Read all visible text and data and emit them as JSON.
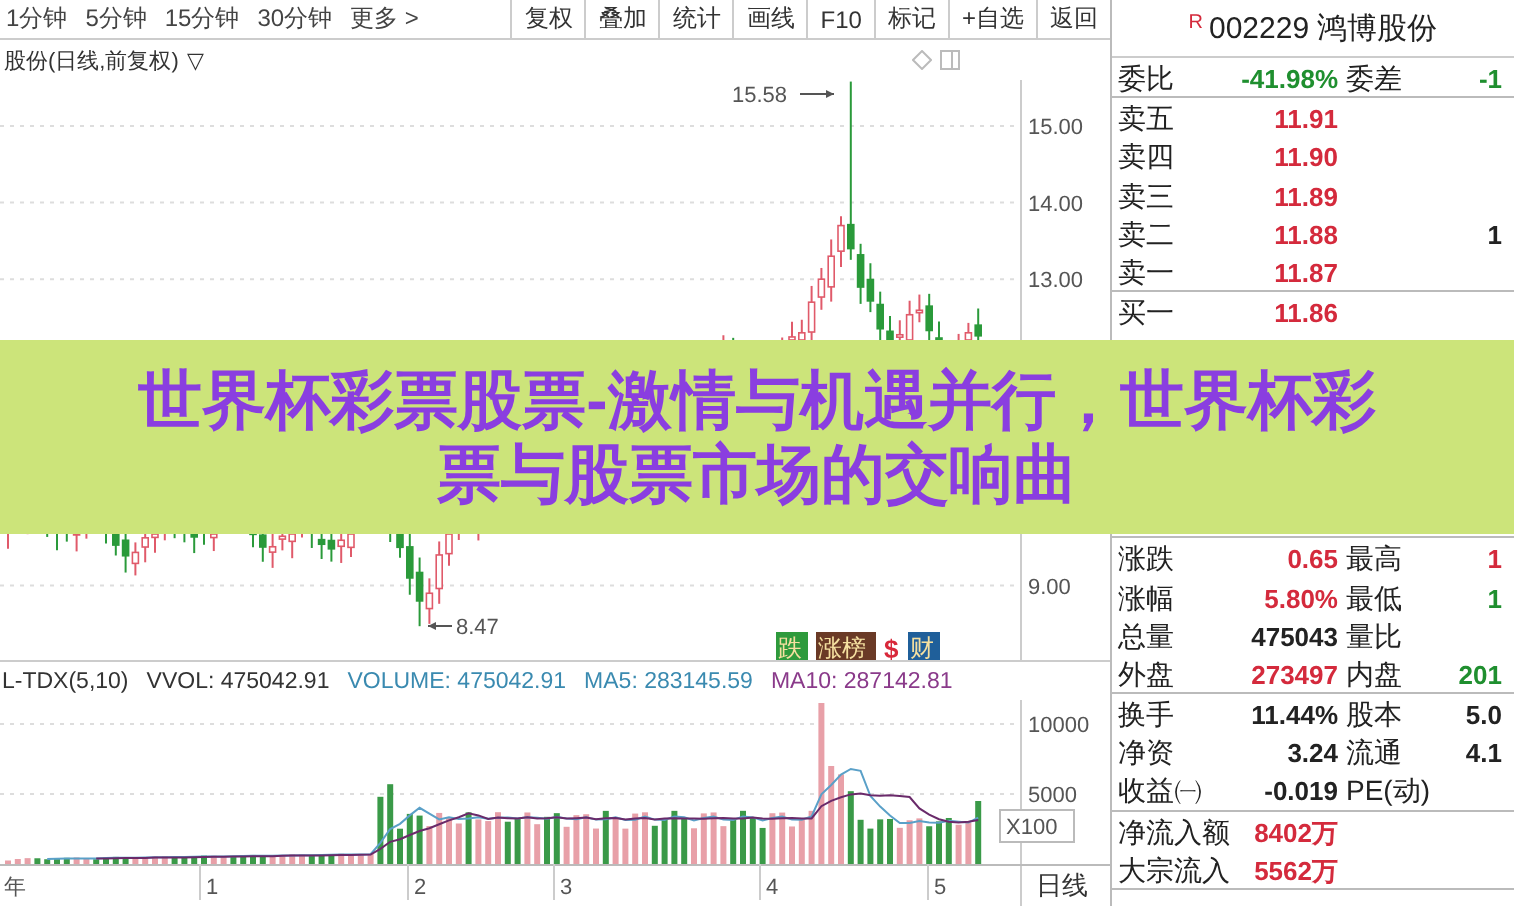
{
  "toolbar": {
    "periods": [
      "1分钟",
      "5分钟",
      "15分钟",
      "30分钟"
    ],
    "more": "更多 >",
    "buttons": [
      "复权",
      "叠加",
      "统计",
      "画线",
      "F10",
      "标记",
      "+自选",
      "返回"
    ]
  },
  "chart": {
    "title": "股份(日线,前复权)",
    "title_menu": "▽",
    "price_axis": [
      "15.00",
      "14.00",
      "13.00",
      "9.00"
    ],
    "high_label": "15.58",
    "low_label": "8.47",
    "badges": [
      {
        "text": "跌",
        "kind": "box",
        "color": "#2e9a3c"
      },
      {
        "text": "涨榜",
        "kind": "box",
        "color": "#6a3a26"
      },
      {
        "text": "$",
        "kind": "mark",
        "color": "#d8283a"
      },
      {
        "text": "财",
        "kind": "box",
        "color": "#1f5f9a"
      }
    ],
    "indicator": [
      {
        "text": "L-TDX(5,10)",
        "color": "#333333"
      },
      {
        "text": "VVOL: 475042.91",
        "color": "#333333"
      },
      {
        "text": "VOLUME: 475042.91",
        "color": "#3a8ab0"
      },
      {
        "text": "MA5: 283145.59",
        "color": "#3a8ab0"
      },
      {
        "text": "MA10: 287142.81",
        "color": "#8a3a8a"
      }
    ],
    "volume_axis": [
      "10000",
      "5000"
    ],
    "volume_unit": "X100",
    "dates": [
      "年",
      "1",
      "2",
      "3",
      "4",
      "5"
    ],
    "period": "日线"
  },
  "quote": {
    "flag": "R",
    "title": "002229 鸿博股份",
    "ratio": {
      "label": "委比",
      "value": "-41.98%",
      "color": "#1f8f2f",
      "right": {
        "label": "委差",
        "value": "-1",
        "color": "#1f8f2f"
      }
    },
    "asks": [
      {
        "label": "卖五",
        "value": "11.91",
        "color": "#d42a3c"
      },
      {
        "label": "卖四",
        "value": "11.90",
        "color": "#d42a3c"
      },
      {
        "label": "卖三",
        "value": "11.89",
        "color": "#d42a3c"
      },
      {
        "label": "卖二",
        "value": "11.88",
        "color": "#d42a3c",
        "right": {
          "value": "1",
          "color": "#222222"
        }
      },
      {
        "label": "卖一",
        "value": "11.87",
        "color": "#d42a3c"
      }
    ],
    "bids": [
      {
        "label": "买一",
        "value": "11.86",
        "color": "#d42a3c"
      }
    ],
    "stats": [
      {
        "label": "涨跌",
        "value": "0.65",
        "color": "#d42a3c",
        "right": {
          "label": "最高",
          "value": "1",
          "color": "#d42a3c"
        }
      },
      {
        "label": "涨幅",
        "value": "5.80%",
        "color": "#d42a3c",
        "right": {
          "label": "最低",
          "value": "1",
          "color": "#1f8f2f"
        }
      },
      {
        "label": "总量",
        "value": "475043",
        "color": "#222222",
        "right": {
          "label": "量比"
        }
      },
      {
        "label": "外盘",
        "value": "273497",
        "color": "#d42a3c",
        "right": {
          "label": "内盘",
          "value": "201",
          "color": "#1f8f2f"
        }
      }
    ],
    "fundamentals": [
      {
        "label": "换手",
        "value": "11.44%",
        "color": "#222222",
        "right": {
          "label": "股本",
          "value": "5.0",
          "color": "#222222"
        }
      },
      {
        "label": "净资",
        "value": "3.24",
        "color": "#222222",
        "right": {
          "label": "流通",
          "value": "4.1",
          "color": "#222222"
        }
      },
      {
        "label": "收益㈠",
        "value": "-0.019",
        "color": "#222222",
        "right": {
          "label": "PE(动)"
        }
      }
    ],
    "flows": [
      {
        "label": "净流入额",
        "value": "8402万",
        "color": "#d42a3c"
      },
      {
        "label": "大宗流入",
        "value": "5562万",
        "color": "#d42a3c"
      }
    ]
  },
  "banner": {
    "headline": "世界杯彩票股票-激情与机遇并行，世界杯彩票与股票市场的交响曲"
  }
}
